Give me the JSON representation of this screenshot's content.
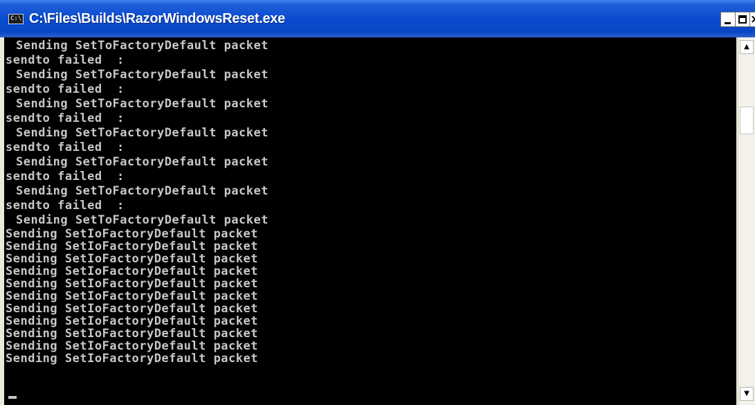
{
  "window": {
    "title": "C:\\Files\\Builds\\RazorWindowsReset.exe",
    "icon": "console-app-icon",
    "icon_glyph": "C:\\",
    "controls": {
      "minimize_icon": "minimize-icon",
      "maximize_icon": "maximize-icon",
      "close_label": "×"
    }
  },
  "scrollbar": {
    "up_arrow": "▲",
    "down_arrow": "▼"
  },
  "console": {
    "lines": [
      {
        "text": "Sending SetToFactoryDefault packet",
        "indent": true
      },
      {
        "text": "sendto failed  :",
        "indent": false
      },
      {
        "text": "Sending SetToFactoryDefault packet",
        "indent": true
      },
      {
        "text": "sendto failed  :",
        "indent": false
      },
      {
        "text": "Sending SetToFactoryDefault packet",
        "indent": true
      },
      {
        "text": "sendto failed  :",
        "indent": false
      },
      {
        "text": "Sending SetToFactoryDefault packet",
        "indent": true
      },
      {
        "text": "sendto failed  :",
        "indent": false
      },
      {
        "text": "Sending SetToFactoryDefault packet",
        "indent": true
      },
      {
        "text": "sendto failed  :",
        "indent": false
      },
      {
        "text": "Sending SetToFactoryDefault packet",
        "indent": true
      },
      {
        "text": "sendto failed  :",
        "indent": false
      },
      {
        "text": "Sending SetToFactoryDefault packet",
        "indent": true
      },
      {
        "text": "Sending SetIoFactoryDefault packet",
        "indent": false
      },
      {
        "text": "Sending SetIoFactoryDefault packet",
        "indent": false
      },
      {
        "text": "Sending SetIoFactoryDefault packet",
        "indent": false
      },
      {
        "text": "Sending SetIoFactoryDefault packet",
        "indent": false
      },
      {
        "text": "Sending SetIoFactoryDefault packet",
        "indent": false
      },
      {
        "text": "Sending SetIoFactoryDefault packet",
        "indent": false
      },
      {
        "text": "Sending SetIoFactoryDefault packet",
        "indent": false
      },
      {
        "text": "Sending SetIoFactoryDefault packet",
        "indent": false
      },
      {
        "text": "Sending SetIoFactoryDefault packet",
        "indent": false
      },
      {
        "text": "Sending SetIoFactoryDefault packet",
        "indent": false
      },
      {
        "text": "Sending SetIoFactoryDefault packet",
        "indent": false
      }
    ]
  },
  "colors": {
    "titlebar": "#0846c6",
    "console_background": "#000000",
    "console_text": "#c8c8c8"
  }
}
